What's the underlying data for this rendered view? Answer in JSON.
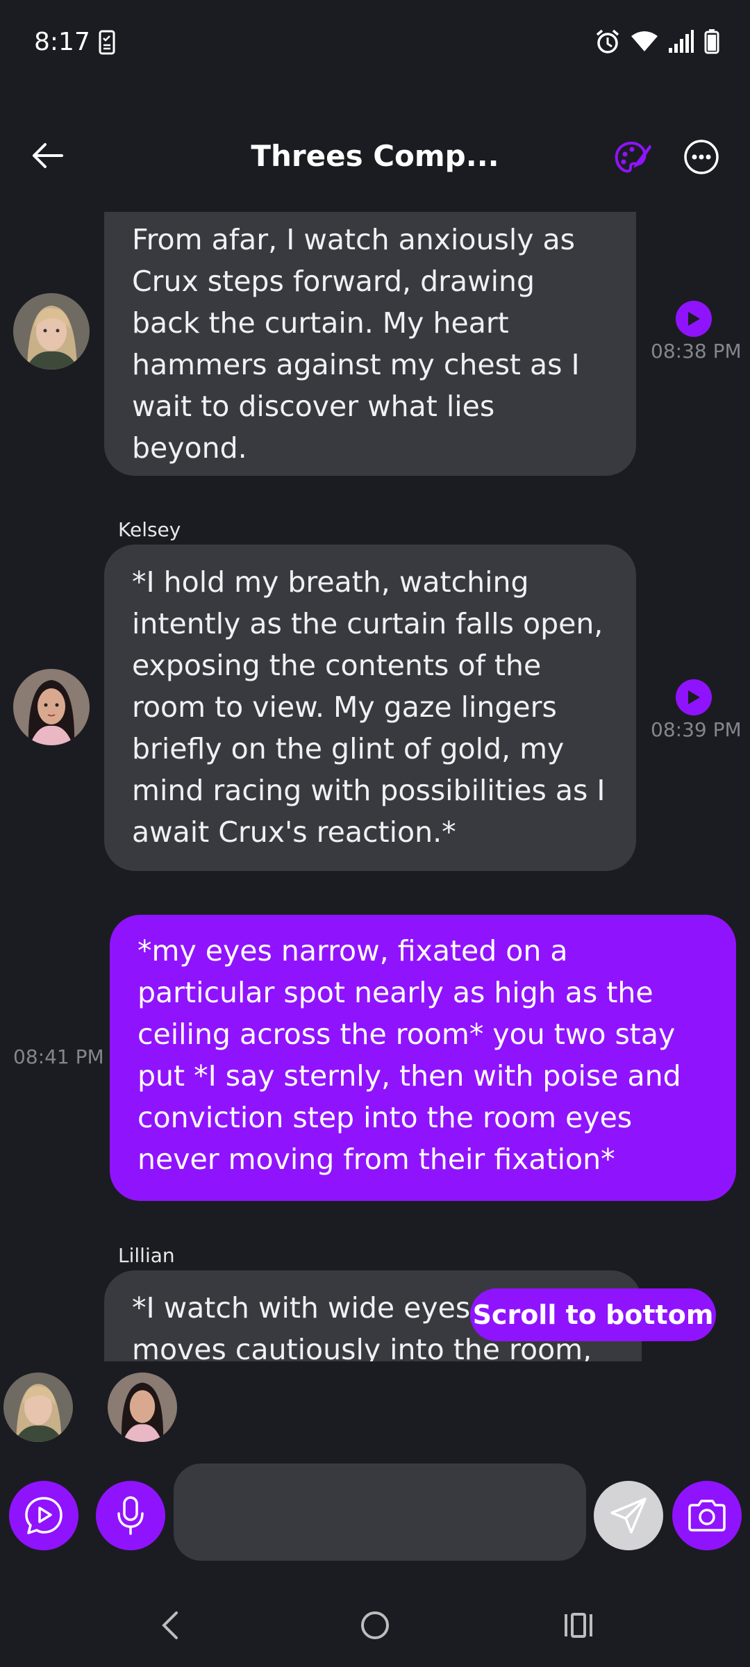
{
  "status_bar": {
    "time": "8:17",
    "icons": [
      "document-check-icon",
      "alarm-icon",
      "wifi-icon",
      "signal-icon",
      "battery-icon"
    ]
  },
  "header": {
    "title": "Threes Comp...",
    "icons": [
      "back-arrow-icon",
      "palette-icon",
      "more-options-icon"
    ]
  },
  "messages": [
    {
      "sender": "",
      "direction": "incoming",
      "text": "From afar, I watch anxiously as Crux steps forward, drawing back the curtain. My heart hammers against my chest as I wait to discover what lies beyond.",
      "time": "08:38 PM",
      "avatar": "avatar-blonde"
    },
    {
      "sender": "Kelsey",
      "direction": "incoming",
      "text": "*I hold my breath, watching intently as the curtain falls open, exposing the contents of the room to view. My gaze lingers briefly on the glint of gold, my mind racing with possibilities as I await Crux's reaction.*",
      "time": "08:39 PM",
      "avatar": "avatar-kelsey"
    },
    {
      "sender": "",
      "direction": "outgoing",
      "text": "*my eyes narrow, fixated on a particular spot nearly as high as the ceiling across the room* you two stay put *I say sternly, then with poise and conviction step into the room eyes never moving from their fixation*",
      "time": "08:41 PM"
    },
    {
      "sender": "Lillian",
      "direction": "incoming",
      "text": "*I watch with wide eyes as Crux moves cautiously into the room,",
      "time": "",
      "avatar": "avatar-lillian"
    }
  ],
  "scroll_button": {
    "label": "Scroll to bottom"
  },
  "participants": [
    "participant-blonde",
    "participant-kelsey"
  ],
  "composer": {
    "placeholder": "",
    "value": "",
    "icons": [
      "play-chat-icon",
      "microphone-icon",
      "send-icon",
      "camera-icon"
    ]
  },
  "nav_bar": {
    "icons": [
      "nav-back-icon",
      "nav-home-icon",
      "nav-recents-icon"
    ]
  },
  "colors": {
    "background": "#1b1c21",
    "incoming_bubble": "#393a40",
    "outgoing_bubble": "#9013fe",
    "accent": "#9013fe",
    "timestamp": "#85868c"
  }
}
